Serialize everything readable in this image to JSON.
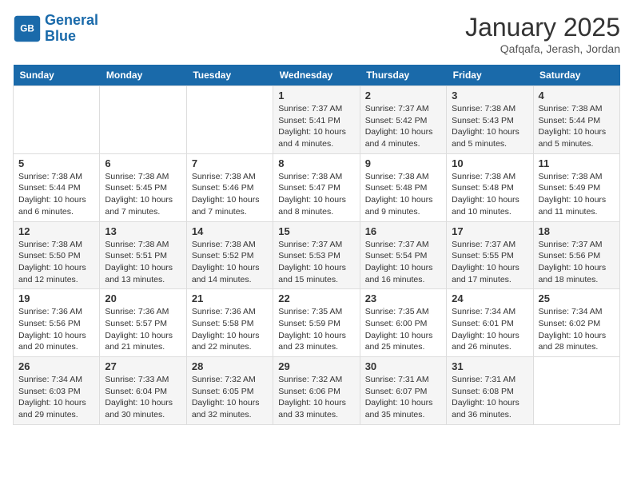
{
  "header": {
    "logo_line1": "General",
    "logo_line2": "Blue",
    "month": "January 2025",
    "location": "Qafqafa, Jerash, Jordan"
  },
  "weekdays": [
    "Sunday",
    "Monday",
    "Tuesday",
    "Wednesday",
    "Thursday",
    "Friday",
    "Saturday"
  ],
  "weeks": [
    [
      {
        "day": "",
        "info": ""
      },
      {
        "day": "",
        "info": ""
      },
      {
        "day": "",
        "info": ""
      },
      {
        "day": "1",
        "info": "Sunrise: 7:37 AM\nSunset: 5:41 PM\nDaylight: 10 hours\nand 4 minutes."
      },
      {
        "day": "2",
        "info": "Sunrise: 7:37 AM\nSunset: 5:42 PM\nDaylight: 10 hours\nand 4 minutes."
      },
      {
        "day": "3",
        "info": "Sunrise: 7:38 AM\nSunset: 5:43 PM\nDaylight: 10 hours\nand 5 minutes."
      },
      {
        "day": "4",
        "info": "Sunrise: 7:38 AM\nSunset: 5:44 PM\nDaylight: 10 hours\nand 5 minutes."
      }
    ],
    [
      {
        "day": "5",
        "info": "Sunrise: 7:38 AM\nSunset: 5:44 PM\nDaylight: 10 hours\nand 6 minutes."
      },
      {
        "day": "6",
        "info": "Sunrise: 7:38 AM\nSunset: 5:45 PM\nDaylight: 10 hours\nand 7 minutes."
      },
      {
        "day": "7",
        "info": "Sunrise: 7:38 AM\nSunset: 5:46 PM\nDaylight: 10 hours\nand 7 minutes."
      },
      {
        "day": "8",
        "info": "Sunrise: 7:38 AM\nSunset: 5:47 PM\nDaylight: 10 hours\nand 8 minutes."
      },
      {
        "day": "9",
        "info": "Sunrise: 7:38 AM\nSunset: 5:48 PM\nDaylight: 10 hours\nand 9 minutes."
      },
      {
        "day": "10",
        "info": "Sunrise: 7:38 AM\nSunset: 5:48 PM\nDaylight: 10 hours\nand 10 minutes."
      },
      {
        "day": "11",
        "info": "Sunrise: 7:38 AM\nSunset: 5:49 PM\nDaylight: 10 hours\nand 11 minutes."
      }
    ],
    [
      {
        "day": "12",
        "info": "Sunrise: 7:38 AM\nSunset: 5:50 PM\nDaylight: 10 hours\nand 12 minutes."
      },
      {
        "day": "13",
        "info": "Sunrise: 7:38 AM\nSunset: 5:51 PM\nDaylight: 10 hours\nand 13 minutes."
      },
      {
        "day": "14",
        "info": "Sunrise: 7:38 AM\nSunset: 5:52 PM\nDaylight: 10 hours\nand 14 minutes."
      },
      {
        "day": "15",
        "info": "Sunrise: 7:37 AM\nSunset: 5:53 PM\nDaylight: 10 hours\nand 15 minutes."
      },
      {
        "day": "16",
        "info": "Sunrise: 7:37 AM\nSunset: 5:54 PM\nDaylight: 10 hours\nand 16 minutes."
      },
      {
        "day": "17",
        "info": "Sunrise: 7:37 AM\nSunset: 5:55 PM\nDaylight: 10 hours\nand 17 minutes."
      },
      {
        "day": "18",
        "info": "Sunrise: 7:37 AM\nSunset: 5:56 PM\nDaylight: 10 hours\nand 18 minutes."
      }
    ],
    [
      {
        "day": "19",
        "info": "Sunrise: 7:36 AM\nSunset: 5:56 PM\nDaylight: 10 hours\nand 20 minutes."
      },
      {
        "day": "20",
        "info": "Sunrise: 7:36 AM\nSunset: 5:57 PM\nDaylight: 10 hours\nand 21 minutes."
      },
      {
        "day": "21",
        "info": "Sunrise: 7:36 AM\nSunset: 5:58 PM\nDaylight: 10 hours\nand 22 minutes."
      },
      {
        "day": "22",
        "info": "Sunrise: 7:35 AM\nSunset: 5:59 PM\nDaylight: 10 hours\nand 23 minutes."
      },
      {
        "day": "23",
        "info": "Sunrise: 7:35 AM\nSunset: 6:00 PM\nDaylight: 10 hours\nand 25 minutes."
      },
      {
        "day": "24",
        "info": "Sunrise: 7:34 AM\nSunset: 6:01 PM\nDaylight: 10 hours\nand 26 minutes."
      },
      {
        "day": "25",
        "info": "Sunrise: 7:34 AM\nSunset: 6:02 PM\nDaylight: 10 hours\nand 28 minutes."
      }
    ],
    [
      {
        "day": "26",
        "info": "Sunrise: 7:34 AM\nSunset: 6:03 PM\nDaylight: 10 hours\nand 29 minutes."
      },
      {
        "day": "27",
        "info": "Sunrise: 7:33 AM\nSunset: 6:04 PM\nDaylight: 10 hours\nand 30 minutes."
      },
      {
        "day": "28",
        "info": "Sunrise: 7:32 AM\nSunset: 6:05 PM\nDaylight: 10 hours\nand 32 minutes."
      },
      {
        "day": "29",
        "info": "Sunrise: 7:32 AM\nSunset: 6:06 PM\nDaylight: 10 hours\nand 33 minutes."
      },
      {
        "day": "30",
        "info": "Sunrise: 7:31 AM\nSunset: 6:07 PM\nDaylight: 10 hours\nand 35 minutes."
      },
      {
        "day": "31",
        "info": "Sunrise: 7:31 AM\nSunset: 6:08 PM\nDaylight: 10 hours\nand 36 minutes."
      },
      {
        "day": "",
        "info": ""
      }
    ]
  ]
}
